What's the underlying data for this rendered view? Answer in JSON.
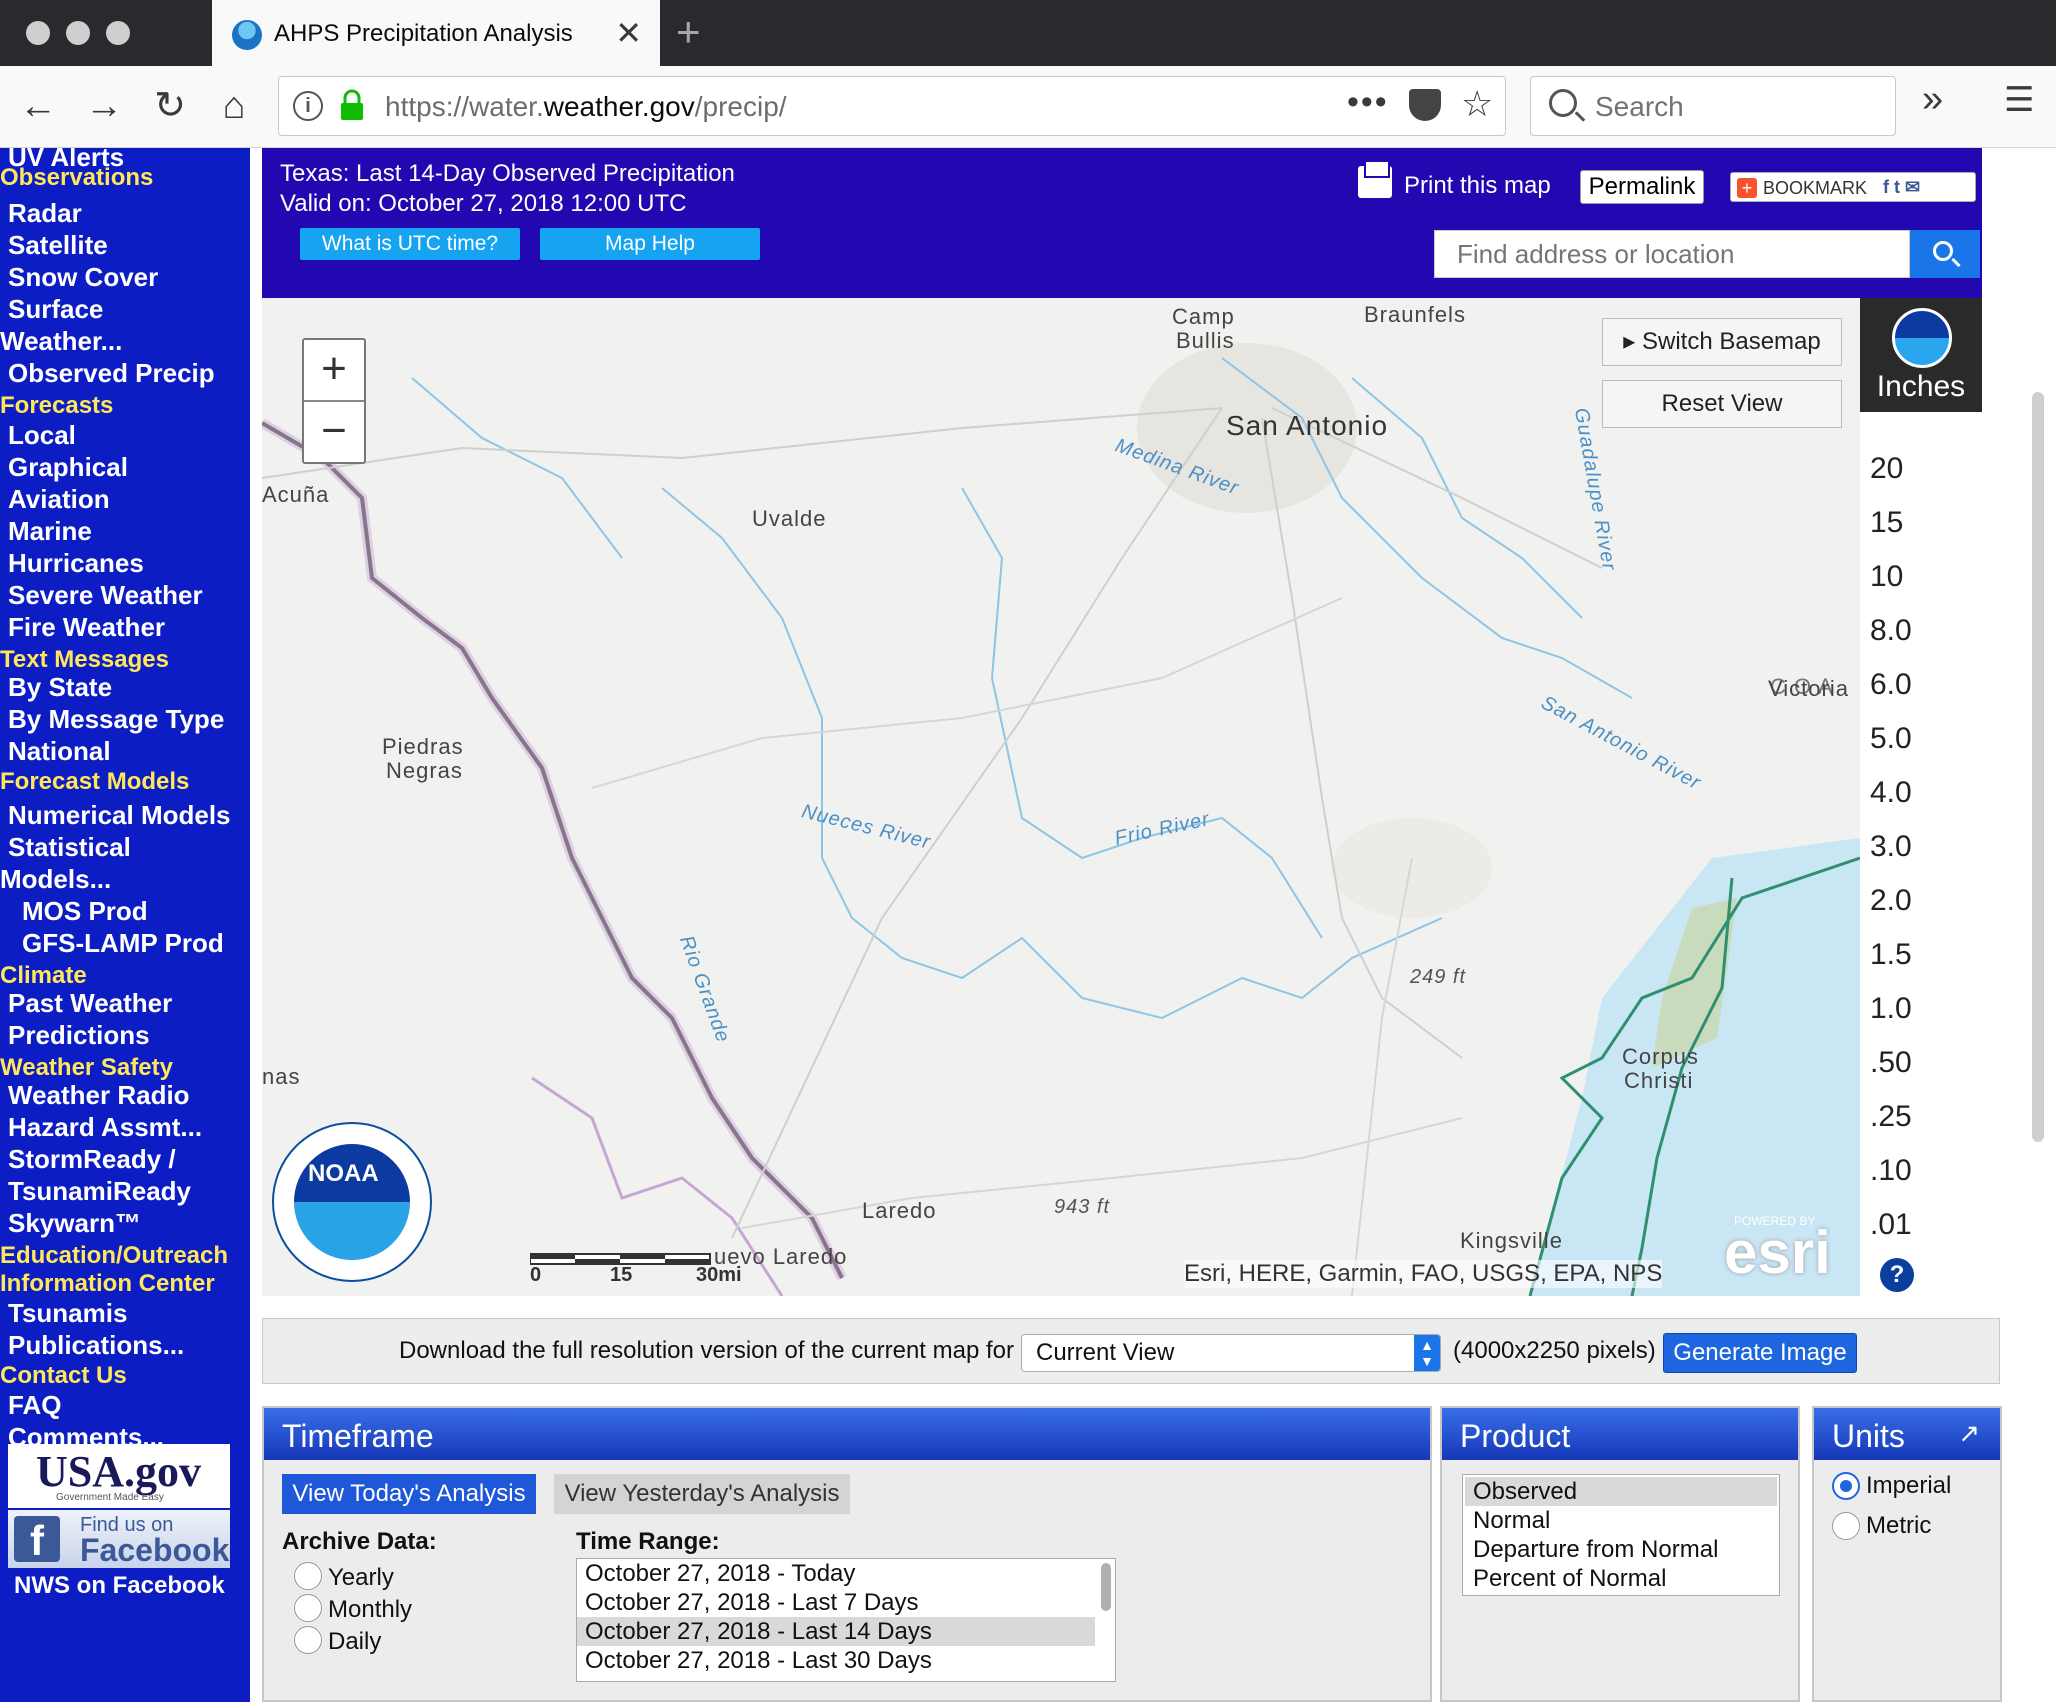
{
  "browser": {
    "tab_title": "AHPS Precipitation Analysis",
    "url_prefix": "https://water.",
    "url_domain": "weather.gov",
    "url_path": "/precip/",
    "search_placeholder": "Search"
  },
  "sidebar": {
    "items": [
      {
        "label": "UV Alerts",
        "type": "item"
      },
      {
        "label": "Observations",
        "type": "head"
      },
      {
        "label": "Radar",
        "type": "item"
      },
      {
        "label": "Satellite",
        "type": "item"
      },
      {
        "label": "Snow Cover",
        "type": "item"
      },
      {
        "label": "Surface",
        "type": "item"
      },
      {
        "label": "Weather...",
        "type": "item2"
      },
      {
        "label": "Observed Precip",
        "type": "item"
      },
      {
        "label": "Forecasts",
        "type": "head"
      },
      {
        "label": "Local",
        "type": "item"
      },
      {
        "label": "Graphical",
        "type": "item"
      },
      {
        "label": "Aviation",
        "type": "item"
      },
      {
        "label": "Marine",
        "type": "item"
      },
      {
        "label": "Hurricanes",
        "type": "item"
      },
      {
        "label": "Severe Weather",
        "type": "item"
      },
      {
        "label": "Fire Weather",
        "type": "item"
      },
      {
        "label": "Text Messages",
        "type": "head"
      },
      {
        "label": "By State",
        "type": "item"
      },
      {
        "label": "By Message Type",
        "type": "item"
      },
      {
        "label": "National",
        "type": "item"
      },
      {
        "label": "Forecast Models",
        "type": "head"
      },
      {
        "label": "Numerical Models",
        "type": "item"
      },
      {
        "label": "Statistical",
        "type": "item"
      },
      {
        "label": "Models...",
        "type": "item2"
      },
      {
        "label": "MOS Prod",
        "type": "sub"
      },
      {
        "label": "GFS-LAMP Prod",
        "type": "sub"
      },
      {
        "label": "Climate",
        "type": "head"
      },
      {
        "label": "Past Weather",
        "type": "item"
      },
      {
        "label": "Predictions",
        "type": "item"
      },
      {
        "label": "Weather Safety",
        "type": "head"
      },
      {
        "label": "Weather Radio",
        "type": "item"
      },
      {
        "label": "Hazard Assmt...",
        "type": "item"
      },
      {
        "label": "StormReady /",
        "type": "item"
      },
      {
        "label": "TsunamiReady",
        "type": "item"
      },
      {
        "label": "Skywarn™",
        "type": "item"
      },
      {
        "label": "Education/Outreach",
        "type": "head"
      },
      {
        "label": "Information Center",
        "type": "head"
      },
      {
        "label": "Tsunamis",
        "type": "item"
      },
      {
        "label": "Publications...",
        "type": "item"
      },
      {
        "label": "Contact Us",
        "type": "head"
      },
      {
        "label": "FAQ",
        "type": "item"
      },
      {
        "label": "Comments...",
        "type": "item"
      }
    ],
    "usa_gov": "USA.gov",
    "usa_gov_sub": "Government Made Easy",
    "fb_top": "Find us on",
    "fb_big": "Facebook",
    "nws_facebook": "NWS on Facebook"
  },
  "header": {
    "title": "Texas: Last 14-Day Observed Precipitation",
    "valid": "Valid on: October 27, 2018 12:00 UTC",
    "utc_button": "What is UTC time?",
    "help_button": "Map Help",
    "print_label": "Print this map",
    "permalink": "Permalink",
    "bookmark": "BOOKMARK",
    "find_placeholder": "Find address or location"
  },
  "map": {
    "switch_basemap": "Switch Basemap",
    "reset_view": "Reset View",
    "labels": {
      "camp_bullis_1": "Camp",
      "camp_bullis_2": "Bullis",
      "new_braunfels": "Braunfels",
      "san_antonio": "San Antonio",
      "medina_river": "Medina River",
      "acuna": "Acuña",
      "uvalde": "Uvalde",
      "guadalupe_river": "Guadalupe River",
      "victoria": "Victoria",
      "san_antonio_river": "San Antonio River",
      "piedras_negras_1": "Piedras",
      "piedras_negras_2": "Negras",
      "nueces_river": "Nueces River",
      "frio_river": "Frio River",
      "elev_249": "249 ft",
      "corpus_1": "Corpus",
      "corpus_2": "Christi",
      "rio_grande": "Rio Grande",
      "laredo": "Laredo",
      "nuevo_laredo": "uevo Laredo",
      "elev_943": "943 ft",
      "kingsville": "Kingsville",
      "nas": "nas"
    },
    "scale": {
      "s0": "0",
      "s15": "15",
      "s30": "30mi"
    },
    "attribution": "Esri, HERE, Garmin, FAO, USGS, EPA, NPS",
    "esri_powered": "POWERED BY",
    "esri": "esri",
    "noaa": "NOAA"
  },
  "legend": {
    "units": "Inches",
    "values": [
      "20",
      "15",
      "10",
      "8.0",
      "6.0",
      "5.0",
      "4.0",
      "3.0",
      "2.0",
      "1.5",
      "1.0",
      ".50",
      ".25",
      ".10",
      ".01"
    ],
    "colors": [
      "#fdfdfd",
      "#bf7fe6",
      "#7800c6",
      "#f300f3",
      "#a50000",
      "#e10000",
      "#ff6600",
      "#ffb600",
      "#ffe500",
      "#007300",
      "#00b500",
      "#00ec00",
      "#0019ff",
      "#0094ff",
      "#00d2ff"
    ]
  },
  "download": {
    "text": "Download the full resolution version of the current map for",
    "selected": "Current View",
    "size": "(4000x2250 pixels)",
    "button": "Generate Image"
  },
  "timeframe": {
    "title": "Timeframe",
    "today_button": "View Today's Analysis",
    "yesterday_button": "View Yesterday's Analysis",
    "archive_label": "Archive Data:",
    "archive_options": [
      "Yearly",
      "Monthly",
      "Daily"
    ],
    "range_label": "Time Range:",
    "ranges": [
      "October 27, 2018 - Today",
      "October 27, 2018 - Last 7 Days",
      "October 27, 2018 - Last 14 Days",
      "October 27, 2018 - Last 30 Days"
    ],
    "selected_range": 2
  },
  "product": {
    "title": "Product",
    "options": [
      "Observed",
      "Normal",
      "Departure from Normal",
      "Percent of Normal"
    ],
    "selected": 0
  },
  "units": {
    "title": "Units",
    "options": [
      "Imperial",
      "Metric"
    ],
    "selected": 0
  }
}
